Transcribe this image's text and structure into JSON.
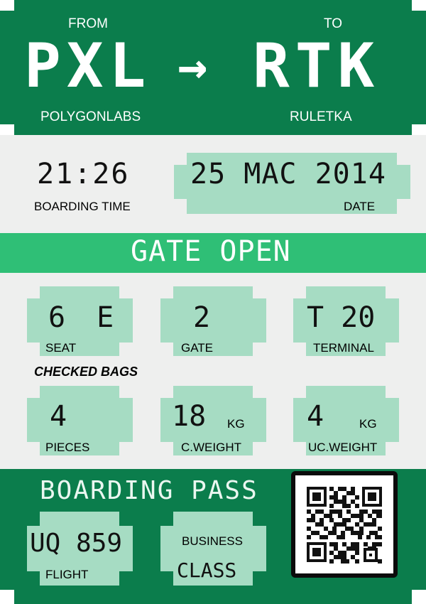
{
  "header": {
    "from_label": "FROM",
    "to_label": "TO",
    "from_code": "PXL",
    "arrow": "→",
    "to_code": "RTK",
    "from_name": "POLYGONLABS",
    "to_name": "RULETKA"
  },
  "boarding": {
    "time": "21:26",
    "time_label": "BOARDING TIME",
    "date": "25 MAC 2014",
    "date_label": "DATE"
  },
  "status": {
    "text": "GATE OPEN"
  },
  "details": {
    "seat_value": "6 E",
    "seat_label": "SEAT",
    "gate_value": "2",
    "gate_label": "GATE",
    "terminal_value": "T 20",
    "terminal_label": "TERMINAL"
  },
  "bags": {
    "heading": "CHECKED BAGS",
    "pieces_value": "4",
    "pieces_label": "PIECES",
    "cweight_value": "18",
    "cweight_unit": "KG",
    "cweight_label": "C.WEIGHT",
    "ucweight_value": "4",
    "ucweight_unit": "KG",
    "ucweight_label": "UC.WEIGHT"
  },
  "footer": {
    "title": "BOARDING PASS",
    "flight_value": "UQ 859",
    "flight_label": "FLIGHT",
    "class_top": "BUSINESS",
    "class_value": "CLASS"
  },
  "colors": {
    "dark_green": "#0b7d4c",
    "bright_green": "#2fbf76",
    "mint": "#a6dcc3",
    "light_gray": "#eeefee"
  }
}
